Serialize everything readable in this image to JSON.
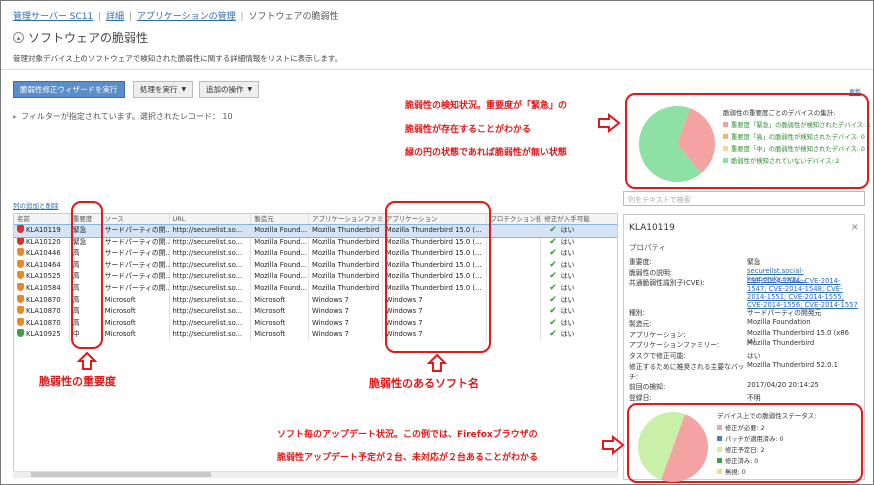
{
  "breadcrumb": {
    "items": [
      "管理サーバー SC11",
      "詳細",
      "アプリケーションの管理"
    ],
    "current": "ソフトウェアの脆弱性",
    "separator": "|"
  },
  "page": {
    "title": "ソフトウェアの脆弱性",
    "description": "管理対象デバイス上のソフトウェアで検知された脆弱性に関する詳細情報をリストに表示します。"
  },
  "toolbar": {
    "wizard_label": "脆弱性修正ウィザードを実行",
    "action_label": "処理を実行",
    "more_label": "追加の操作"
  },
  "filter": {
    "text": "フィルターが指定されています。選択されたレコード： 10"
  },
  "links": {
    "columns": "列の追加と削除",
    "right_top": "更新"
  },
  "search": {
    "placeholder": "列をテキストで検索"
  },
  "table": {
    "headers": [
      "名前",
      "重要度",
      "ソース",
      "URL",
      "製造元",
      "アプリケーションファミリー",
      "アプリケーション",
      "プロテクション技術",
      "修正が入手可能"
    ],
    "rows": [
      {
        "name": "KLA10119",
        "sev": "緊急",
        "src": "サードパーティの開...",
        "url": "http://securelist.so...",
        "vendor": "Mozilla Found...",
        "family": "Mozilla Thunderbird",
        "app": "Mozilla Thunderbird 15.0 (...",
        "prot": "",
        "fix": "はい",
        "sevcolor": "#d9342b"
      },
      {
        "name": "KLA10120",
        "sev": "緊急",
        "src": "サードパーティの開...",
        "url": "http://securelist.so...",
        "vendor": "Mozilla Found...",
        "family": "Mozilla Thunderbird",
        "app": "Mozilla Thunderbird 15.0 (...",
        "prot": "",
        "fix": "はい",
        "sevcolor": "#d9342b"
      },
      {
        "name": "KLA10446",
        "sev": "高",
        "src": "サードパーティの開...",
        "url": "http://securelist.so...",
        "vendor": "Mozilla Found...",
        "family": "Mozilla Thunderbird",
        "app": "Mozilla Thunderbird 15.0 (...",
        "prot": "",
        "fix": "はい",
        "sevcolor": "#e88a2a"
      },
      {
        "name": "KLA10464",
        "sev": "高",
        "src": "サードパーティの開...",
        "url": "http://securelist.so...",
        "vendor": "Mozilla Found...",
        "family": "Mozilla Thunderbird",
        "app": "Mozilla Thunderbird 15.0 (...",
        "prot": "",
        "fix": "はい",
        "sevcolor": "#e88a2a"
      },
      {
        "name": "KLA10525",
        "sev": "高",
        "src": "サードパーティの開...",
        "url": "http://securelist.so...",
        "vendor": "Mozilla Found...",
        "family": "Mozilla Thunderbird",
        "app": "Mozilla Thunderbird 15.0 (...",
        "prot": "",
        "fix": "はい",
        "sevcolor": "#e88a2a"
      },
      {
        "name": "KLA10584",
        "sev": "高",
        "src": "サードパーティの開...",
        "url": "http://securelist.so...",
        "vendor": "Mozilla Found...",
        "family": "Mozilla Thunderbird",
        "app": "Mozilla Thunderbird 15.0 (...",
        "prot": "",
        "fix": "はい",
        "sevcolor": "#e88a2a"
      },
      {
        "name": "KLA10870",
        "sev": "高",
        "src": "Microsoft",
        "url": "http://securelist.so...",
        "vendor": "Microsoft",
        "family": "Windows 7",
        "app": "Windows 7",
        "prot": "",
        "fix": "はい",
        "sevcolor": "#e88a2a"
      },
      {
        "name": "KLA10870",
        "sev": "高",
        "src": "Microsoft",
        "url": "http://securelist.so...",
        "vendor": "Microsoft",
        "family": "Windows 7",
        "app": "Windows 7",
        "prot": "",
        "fix": "はい",
        "sevcolor": "#e88a2a"
      },
      {
        "name": "KLA10870",
        "sev": "高",
        "src": "Microsoft",
        "url": "http://securelist.so...",
        "vendor": "Microsoft",
        "family": "Windows 7",
        "app": "Windows 7",
        "prot": "",
        "fix": "はい",
        "sevcolor": "#e88a2a"
      },
      {
        "name": "KLA10925",
        "sev": "中",
        "src": "Microsoft",
        "url": "http://securelist.so...",
        "vendor": "Microsoft",
        "family": "Windows 7",
        "app": "Windows 7",
        "prot": "",
        "fix": "はい",
        "sevcolor": "#3aa34a"
      }
    ]
  },
  "details": {
    "title": "KLA10119",
    "section": "プロパティ",
    "props": [
      {
        "k": "重要度:",
        "v": "緊急",
        "link": false
      },
      {
        "k": "脆弱性の説明:",
        "v": "securelist.social-kaspersky.com/...",
        "link": true
      },
      {
        "k": "共通脆弱性識別子(CVE):",
        "v": "CVE-2014-1544; CVE-2014-1547; CVE-2014-1548; CVE-2014-1551; CVE-2014-1555; CVE-2014-1556; CVE-2014-1557",
        "link": true
      },
      {
        "k": "種別:",
        "v": "サードパーティの開発元",
        "link": false
      },
      {
        "k": "製造元:",
        "v": "Mozilla Foundation",
        "link": false
      },
      {
        "k": "アプリケーション:",
        "v": "Mozilla Thunderbird 15.0 (x86 ja)",
        "link": false
      },
      {
        "k": "アプリケーションファミリー:",
        "v": "Mozilla Thunderbird",
        "link": false
      },
      {
        "k": "タスクで修正可能:",
        "v": "はい",
        "link": false
      },
      {
        "k": "修正するために推奨される主要なパッチ:",
        "v": "Mozilla Thunderbird 52.0.1",
        "link": false
      },
      {
        "k": "前回の検知:",
        "v": "2017/04/20 20:14:25",
        "link": false
      },
      {
        "k": "登録日:",
        "v": "不明",
        "link": false
      }
    ]
  },
  "pie_top": {
    "title": "脆弱性の重要度ごとのデバイスの集計:",
    "legend": [
      {
        "label": "重要度「緊急」の脆弱性が検知されたデバイス: 1",
        "color": "#f4a3a3"
      },
      {
        "label": "重要度「高」の脆弱性が検知されたデバイス: 0",
        "color": "#f2b27a"
      },
      {
        "label": "重要度「中」の脆弱性が検知されたデバイス: 0",
        "color": "#f2dc8a"
      },
      {
        "label": "脆弱性が検知されていないデバイス: 2",
        "color": "#8ee0a5"
      }
    ],
    "shares": [
      1,
      0,
      0,
      2
    ]
  },
  "pie_bottom": {
    "title": "デバイス上での脆弱性ステータス:",
    "legend": [
      {
        "label": "修正が必要: 2",
        "color": "#f4a3a3"
      },
      {
        "label": "パッチが適用済み: 0",
        "color": "#4a7fd0"
      },
      {
        "label": "修正予定日: 2",
        "color": "#c8f0a8"
      },
      {
        "label": "修正済み: 0",
        "color": "#3aa34a"
      },
      {
        "label": "無視: 0",
        "color": "#f2dc8a"
      }
    ],
    "shares": [
      2,
      0,
      2,
      0,
      0
    ]
  },
  "annotations": {
    "top_line1": "脆弱性の検知状況。重要度が「緊急」の",
    "top_line2": "脆弱性が存在することがわかる",
    "top_line3": "緑の円の状態であれば脆弱性が無い状態",
    "severity": "脆弱性の重要度",
    "software": "脆弱性のあるソフト名",
    "bottom_line1": "ソフト毎のアップデート状況。この例では、Firefoxブラウザの",
    "bottom_line2": "脆弱性アップデート予定が２台、未対応が２台あることがわかる"
  }
}
